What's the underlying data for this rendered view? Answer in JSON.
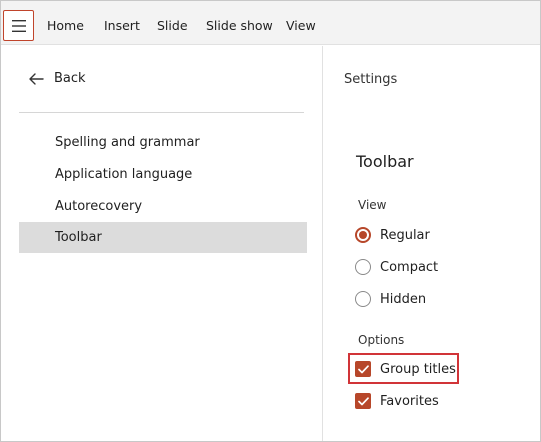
{
  "menubar": {
    "menu_icon": "hamburger-icon",
    "tabs": [
      "Home",
      "Insert",
      "Slide",
      "Slide show",
      "View"
    ]
  },
  "left_pane": {
    "back_label": "Back",
    "back_icon": "arrow-left-icon",
    "items": [
      "Spelling and grammar",
      "Application language",
      "Autorecovery",
      "Toolbar"
    ],
    "selected": "Toolbar"
  },
  "right_pane": {
    "breadcrumb": "Settings",
    "title": "Toolbar",
    "view": {
      "label": "View",
      "options": [
        "Regular",
        "Compact",
        "Hidden"
      ],
      "selected": "Regular"
    },
    "options": {
      "label": "Options",
      "items": [
        {
          "label": "Group titles",
          "checked": true
        },
        {
          "label": "Favorites",
          "checked": true
        }
      ]
    }
  },
  "colors": {
    "accent": "#b7472a",
    "focus_outline": "#d13438",
    "selected_bg": "#dcdcdc",
    "menubar_bg": "#f3f3f3"
  }
}
